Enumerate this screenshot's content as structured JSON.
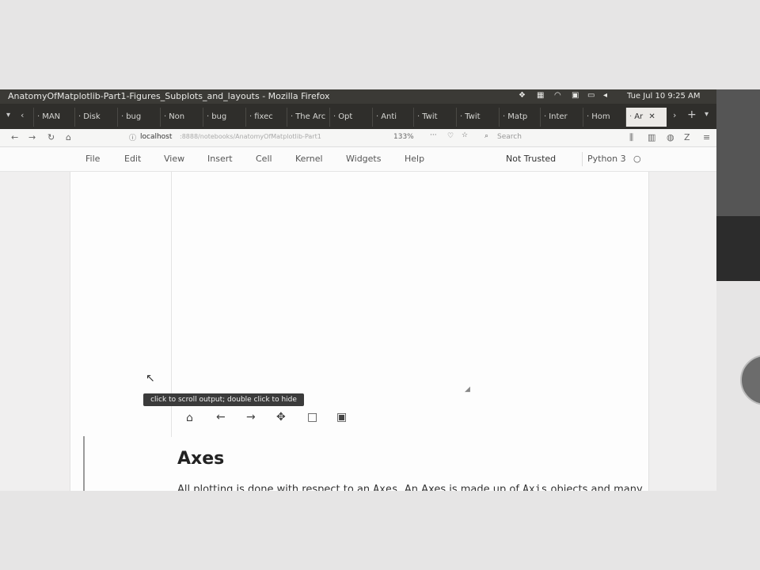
{
  "window_title": "AnatomyOfMatplotlib-Part1-Figures_Subplots_and_layouts - Mozilla Firefox",
  "system": {
    "clock": "Tue Jul 10  9:25 AM"
  },
  "tabs": [
    {
      "label": "MAN"
    },
    {
      "label": "Disk"
    },
    {
      "label": "bug"
    },
    {
      "label": "Non"
    },
    {
      "label": "bug"
    },
    {
      "label": "fixec"
    },
    {
      "label": "The Arc"
    },
    {
      "label": "Opt"
    },
    {
      "label": "Anti"
    },
    {
      "label": "Twit"
    },
    {
      "label": "Twit"
    },
    {
      "label": "Matp"
    },
    {
      "label": "Inter"
    },
    {
      "label": "Hom"
    },
    {
      "label": "Ar"
    }
  ],
  "urlbar": {
    "url_host": "localhost",
    "url_path": ":8888/notebooks/AnatomyOfMatplotlib-Part1",
    "zoom": "133%",
    "search_placeholder": "Search"
  },
  "menu": [
    "File",
    "Edit",
    "View",
    "Insert",
    "Cell",
    "Kernel",
    "Widgets",
    "Help"
  ],
  "trust": "Not Trusted",
  "kernel": "Python 3",
  "tooltip": "click to scroll output; double click to hide",
  "markdown": {
    "heading": "Axes",
    "intro_prefix": "All plotting is done with respect to an",
    "axes_code": "Axes",
    "intro_mid": ". An Axes is made up of",
    "axis_code": "Axis",
    "intro_suffix": "objects and many"
  }
}
